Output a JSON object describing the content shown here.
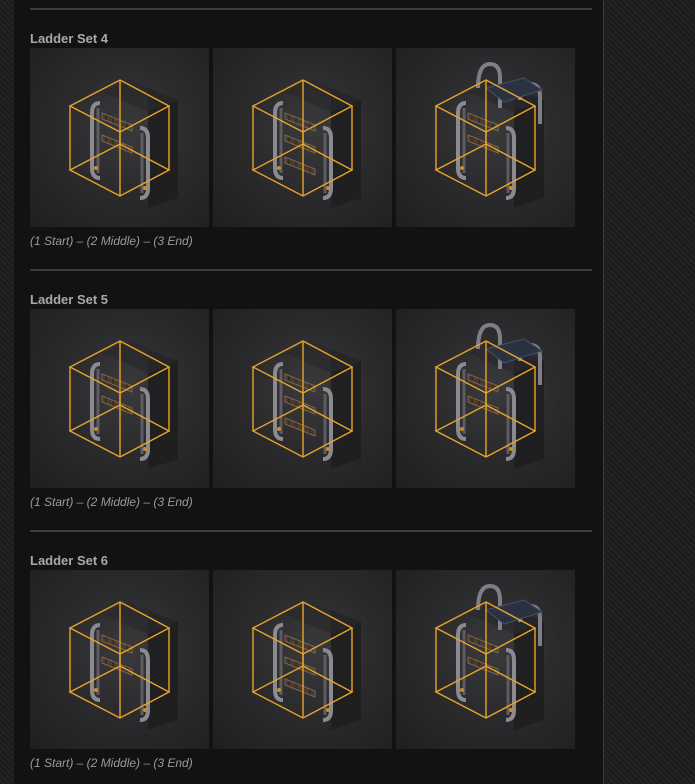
{
  "sets": [
    {
      "title": "Ladder Set 4",
      "caption": "(1 Start) – (2 Middle) – (3 End)",
      "images": [
        {
          "piece": "start"
        },
        {
          "piece": "middle"
        },
        {
          "piece": "end"
        }
      ]
    },
    {
      "title": "Ladder Set 5",
      "caption": "(1 Start) – (2 Middle) – (3 End)",
      "images": [
        {
          "piece": "start"
        },
        {
          "piece": "middle"
        },
        {
          "piece": "end"
        }
      ]
    },
    {
      "title": "Ladder Set 6",
      "caption": "(1 Start) – (2 Middle) – (3 End)",
      "images": [
        {
          "piece": "start"
        },
        {
          "piece": "middle"
        },
        {
          "piece": "end"
        }
      ]
    }
  ],
  "colors": {
    "page_background": "#1a1a1a",
    "panel_background": "#121212",
    "divider": "#3c3c40",
    "title_text": "#a9a9a9",
    "caption_text": "#9a9a9a",
    "bounding_box": "#e8a52a"
  }
}
